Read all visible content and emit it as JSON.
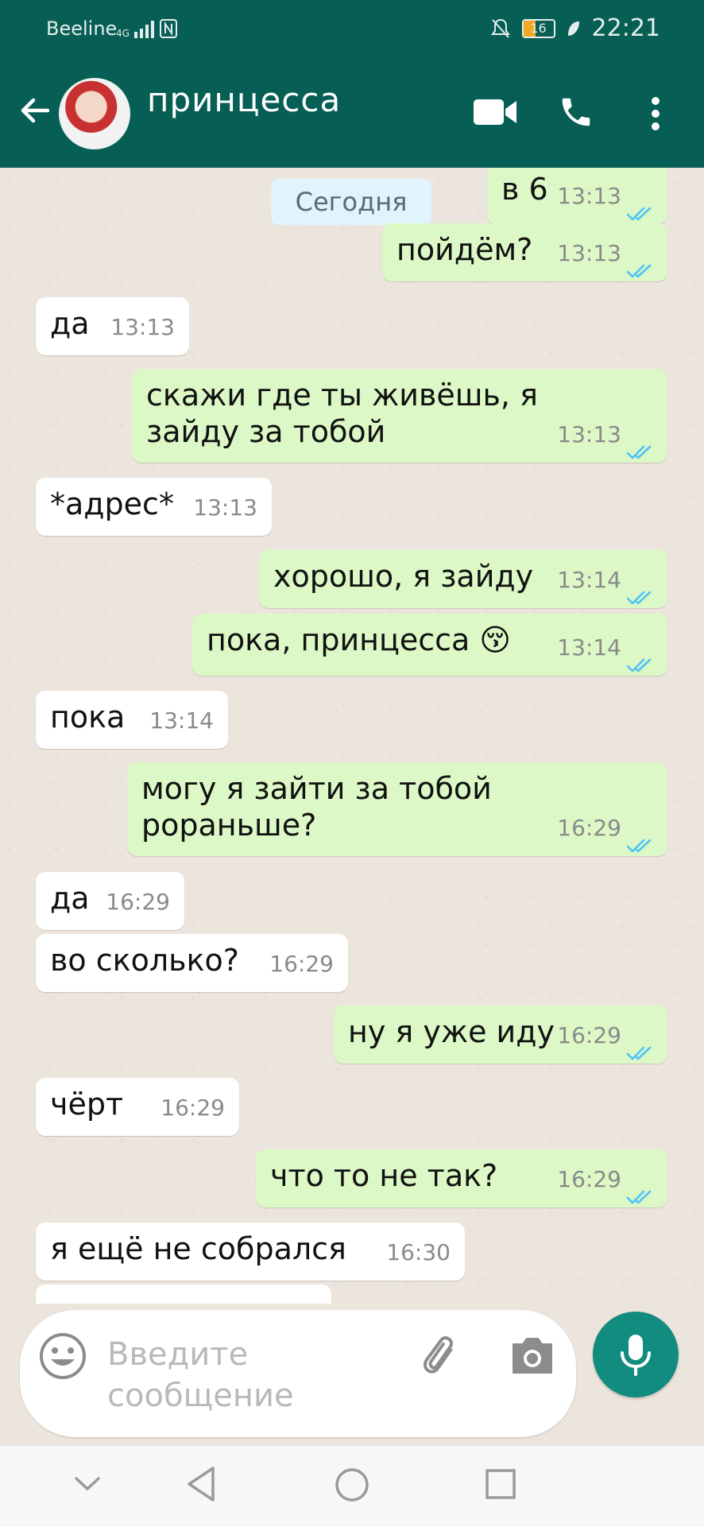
{
  "status_bar": {
    "carrier": "Beeline",
    "network": "4G",
    "battery": "16",
    "time": "22:21"
  },
  "header": {
    "contact_name": "принцесса"
  },
  "chat": {
    "date_chip": "Сегодня",
    "messages": [
      {
        "dir": "out",
        "text": "в 6",
        "time": "13:13",
        "read": true
      },
      {
        "dir": "out",
        "text": "пойдём?",
        "time": "13:13",
        "read": true
      },
      {
        "dir": "in",
        "text": "да",
        "time": "13:13"
      },
      {
        "dir": "out",
        "text": "скажи где ты живёшь, я\nзайду за тобой",
        "time": "13:13",
        "read": true
      },
      {
        "dir": "in",
        "text": "*адрес*",
        "time": "13:13"
      },
      {
        "dir": "out",
        "text": "хорошо, я зайду",
        "time": "13:14",
        "read": true
      },
      {
        "dir": "out",
        "text": "пока, принцесса 😚",
        "time": "13:14",
        "read": true
      },
      {
        "dir": "in",
        "text": "пока",
        "time": "13:14"
      },
      {
        "dir": "out",
        "text": "могу я зайти за тобой\npораньше?",
        "time": "16:29",
        "read": true
      },
      {
        "dir": "in",
        "text": "да",
        "time": "16:29"
      },
      {
        "dir": "in",
        "text": "во сколько?",
        "time": "16:29"
      },
      {
        "dir": "out",
        "text": "ну я уже иду",
        "time": "16:29",
        "read": true
      },
      {
        "dir": "in",
        "text": "чёрт",
        "time": "16:29"
      },
      {
        "dir": "out",
        "text": "что то не так?",
        "time": "16:29",
        "read": true
      },
      {
        "dir": "in",
        "text": "я ещё не собрался",
        "time": "16:30"
      }
    ]
  },
  "composer": {
    "placeholder": "Введите сообщение"
  },
  "colors": {
    "header": "#075e54",
    "outgoing": "#dcf8c6",
    "incoming": "#ffffff",
    "tick": "#4fc3f7",
    "mic": "#128c7e"
  },
  "icons": [
    "back-arrow-icon",
    "video-call-icon",
    "phone-icon",
    "more-vert-icon",
    "emoji-icon",
    "attach-icon",
    "camera-icon",
    "mic-icon",
    "nav-down-icon",
    "nav-back-icon",
    "nav-home-icon",
    "nav-recents-icon"
  ]
}
